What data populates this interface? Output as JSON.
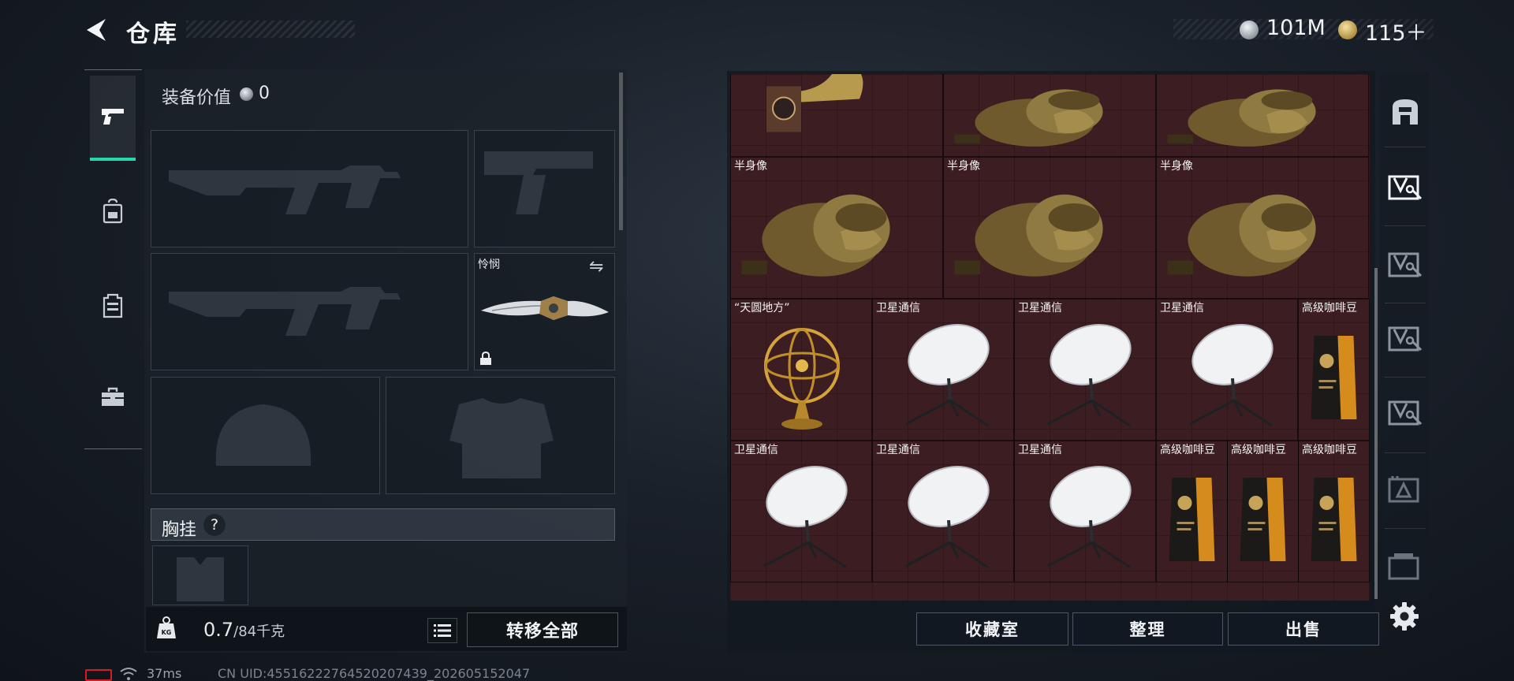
{
  "header": {
    "title": "仓库",
    "currency_silver": "101M",
    "currency_gold": "115＋"
  },
  "loadout": {
    "value_label": "装备价值",
    "value_amount": "0",
    "melee_name": "怜悯",
    "chest_rig_label": "胸挂",
    "help_glyph": "?",
    "weight_current": "0.7",
    "weight_max": "/84千克",
    "transfer_all": "转移全部"
  },
  "tabs": [
    {
      "name": "weapons",
      "icon": "pistol-icon",
      "active": true
    },
    {
      "name": "backpack",
      "icon": "backpack-icon",
      "active": false
    },
    {
      "name": "vest",
      "icon": "vest-icon",
      "active": false
    },
    {
      "name": "toolbox",
      "icon": "toolbox-icon",
      "active": false
    }
  ],
  "stash": {
    "items": [
      {
        "label": "",
        "icon": "gramophone"
      },
      {
        "label": "",
        "icon": "bust"
      },
      {
        "label": "",
        "icon": "bust"
      },
      {
        "label": "半身像",
        "icon": "bust"
      },
      {
        "label": "半身像",
        "icon": "bust"
      },
      {
        "label": "半身像",
        "icon": "bust"
      },
      {
        "label": "“天圆地方”",
        "icon": "armillary-sphere"
      },
      {
        "label": "卫星通信",
        "icon": "satellite-dish"
      },
      {
        "label": "卫星通信",
        "icon": "satellite-dish"
      },
      {
        "label": "卫星通信",
        "icon": "satellite-dish"
      },
      {
        "label": "高级咖啡豆",
        "icon": "coffee-bag"
      },
      {
        "label": "卫星通信",
        "icon": "satellite-dish"
      },
      {
        "label": "卫星通信",
        "icon": "satellite-dish"
      },
      {
        "label": "卫星通信",
        "icon": "satellite-dish"
      },
      {
        "label": "高级咖啡豆",
        "icon": "coffee-bag"
      },
      {
        "label": "高级咖啡豆",
        "icon": "coffee-bag"
      },
      {
        "label": "高级咖啡豆",
        "icon": "coffee-bag"
      }
    ],
    "buttons": {
      "collection": "收藏室",
      "sort": "整理",
      "sell": "出售"
    }
  },
  "status": {
    "ping": "37ms",
    "uid": "CN UID:4551622276452020​7439_202605152047"
  },
  "colors": {
    "accent": "#27d9a8",
    "stash_bg": "#3c1d21",
    "battery": "#d01e28"
  }
}
